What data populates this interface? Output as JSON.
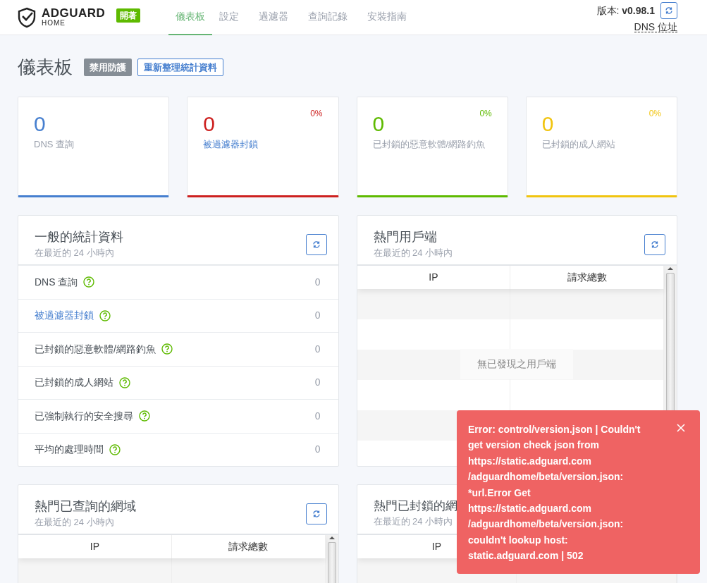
{
  "header": {
    "brand": "ADGUARD",
    "brand_sub": "HOME",
    "status_badge": "開著",
    "nav": [
      {
        "label": "儀表板",
        "selected": true
      },
      {
        "label": "設定",
        "selected": false
      },
      {
        "label": "過濾器",
        "selected": false
      },
      {
        "label": "查詢記錄",
        "selected": false
      },
      {
        "label": "安裝指南",
        "selected": false
      }
    ],
    "version_label": "版本: ",
    "version": "v0.98.1",
    "dns_link": "DNS 位址"
  },
  "page": {
    "title": "儀表板",
    "buttons": [
      {
        "label": "禁用防護",
        "kind": "secondary"
      },
      {
        "label": "重新整理統計資料",
        "kind": "outline"
      }
    ]
  },
  "stat_cards": [
    {
      "value": "0",
      "label": "DNS 查詢",
      "link": false,
      "color": "#467fcf"
    },
    {
      "value": "0",
      "label": "被過濾器封鎖",
      "link": true,
      "percent": "0%",
      "color": "#cd201f"
    },
    {
      "value": "0",
      "label": "已封鎖的惡意軟體/網路釣魚",
      "link": false,
      "percent": "0%",
      "color": "#5eba00"
    },
    {
      "value": "0",
      "label": "已封鎖的成人網站",
      "link": false,
      "percent": "0%",
      "color": "#f1c40f"
    }
  ],
  "general_stats": {
    "title": "一般的統計資料",
    "subtitle": "在最近的 24 小時內",
    "rows": [
      {
        "label": "DNS 查詢",
        "link": false,
        "value": "0"
      },
      {
        "label": "被過濾器封鎖",
        "link": true,
        "value": "0"
      },
      {
        "label": "已封鎖的惡意軟體/網路釣魚",
        "link": false,
        "value": "0"
      },
      {
        "label": "已封鎖的成人網站",
        "link": false,
        "value": "0"
      },
      {
        "label": "已強制執行的安全搜尋",
        "link": false,
        "value": "0"
      },
      {
        "label": "平均的處理時間",
        "link": false,
        "value": "0"
      }
    ]
  },
  "top_clients": {
    "title": "熱門用戶端",
    "subtitle": "在最近的 24 小時內",
    "columns": [
      "IP",
      "請求總數"
    ],
    "empty_text": "無已發現之用戶端"
  },
  "top_queried": {
    "title": "熱門已查詢的網域",
    "subtitle": "在最近的 24 小時內",
    "columns": [
      "IP",
      "請求總數"
    ]
  },
  "top_blocked": {
    "title": "熱門已封鎖的網",
    "subtitle": "在最近的 24 小時內",
    "columns": [
      "IP"
    ]
  },
  "toast": {
    "lines": [
      "Error: control/version.json | Couldn't",
      "get version check json from",
      "https://static.adguard.com",
      "/adguardhome/beta/version.json:",
      "*url.Error Get",
      "https://static.adguard.com",
      "/adguardhome/beta/version.json:",
      "couldn't lookup host:",
      "static.adguard.com | 502"
    ]
  }
}
